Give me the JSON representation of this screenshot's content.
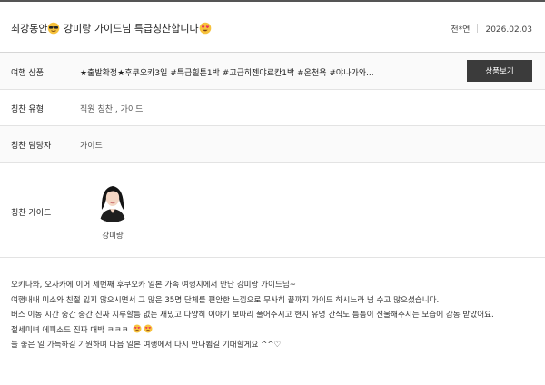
{
  "review": {
    "title_text": "최강동안",
    "title_rest": "강미랑 가이드님 특급칭찬합니다",
    "author": "천*연",
    "date": "2026.02.03"
  },
  "fields": {
    "product_label": "여행 상품",
    "product_value": "★출발확정★후쿠오카3일 #특급힐튼1박 #고급히젠야료칸1박 #온천욕 #야나가와...",
    "product_button": "상품보기",
    "type_label": "칭찬 유형",
    "type_value": "직원 칭찬 , 가이드",
    "staff_label": "칭찬 담당자",
    "staff_value": "가이드",
    "guide_label": "칭찬 가이드",
    "guide_name": "강미랑"
  },
  "content": {
    "line1": "오키나와, 오사카에 이어 세번째 후쿠오카 일본 가족 여행지에서 만난 강미랑 가이드님~",
    "line2": "여행내내 미소와 친절 잃지 않으시면서 그 많은 35명 단체를 편안한 느낌으로 무사히 끝까지 가이드 하시느라 넘 수고 많으셨습니다.",
    "line3": "버스 이동 시간 중간 중간 진짜 지루할틈 없는 재밌고 다양히 이야기 보따리 풀어주시고 현지 유명 간식도 틈틈이 선물해주시는 모습에 감동 받았어요.",
    "line4": "절세미녀 에피소드 진짜 대박 ㅋㅋㅋ",
    "line5": "늘 좋은 일 가득하길 기원하며 다음 일본 여행에서 다시 만나뵙길 기대할게요 ^^♡"
  },
  "icons": {
    "title_emoji_1": "sunglasses-face-emoji",
    "title_emoji_2": "heart-eyes-face-emoji",
    "content_emoji": "heart-eyes-face-emoji"
  },
  "colors": {
    "button_bg": "#3b3b3b",
    "row_alt_bg": "#fafafa",
    "divider": "#e3e3e3"
  }
}
